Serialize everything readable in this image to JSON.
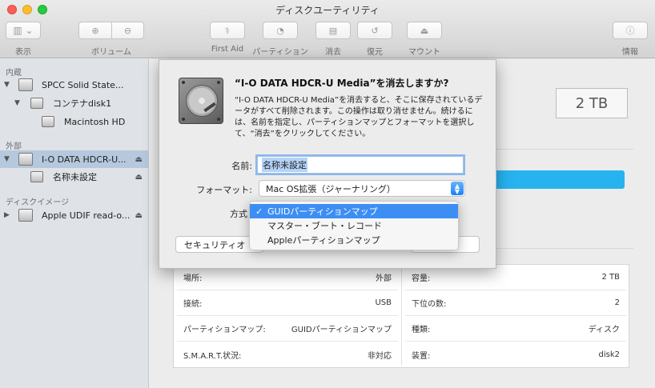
{
  "window": {
    "title": "ディスクユーティリティ"
  },
  "toolbar": {
    "view_label": "表示",
    "volume_label": "ボリューム",
    "first_aid_label": "First Aid",
    "partition_label": "パーティション",
    "erase_label": "消去",
    "restore_label": "復元",
    "mount_label": "マウント",
    "info_label": "情報"
  },
  "sidebar": {
    "sections": {
      "internal": "内蔵",
      "external": "外部",
      "images": "ディスクイメージ"
    },
    "items": [
      {
        "label": "SPCC Solid State..."
      },
      {
        "label": "コンテナdisk1"
      },
      {
        "label": "Macintosh HD"
      },
      {
        "label": "I-O DATA HDCR-U..."
      },
      {
        "label": "名称未設定"
      },
      {
        "label": "Apple UDIF read-o..."
      }
    ]
  },
  "main": {
    "capacity": "2 TB",
    "info_rows": [
      {
        "label": "場所:",
        "value": "外部"
      },
      {
        "label": "接続:",
        "value": "USB"
      },
      {
        "label": "パーティションマップ:",
        "value": "GUIDパーティションマップ"
      },
      {
        "label": "S.M.A.R.T.状況:",
        "value": "非対応"
      },
      {
        "label": "容量:",
        "value": "2 TB"
      },
      {
        "label": "下位の数:",
        "value": "2"
      },
      {
        "label": "種類:",
        "value": "ディスク"
      },
      {
        "label": "装置:",
        "value": "disk2"
      }
    ]
  },
  "dialog": {
    "title": "“I-O DATA HDCR-U Media”を消去しますか?",
    "body": "“I-O DATA HDCR-U Media”を消去すると、そこに保存されているデータがすべて削除されます。この操作は取り消せません。続けるには、名前を指定し、パーティションマップとフォーマットを選択して、“消去”をクリックしてください。",
    "name_label": "名前:",
    "name_value": "名称未設定",
    "format_label": "フォーマット:",
    "format_value": "Mac OS拡張（ジャーナリング）",
    "scheme_label": "方式",
    "security_button": "セキュリティオ"
  },
  "scheme_menu": {
    "options": [
      "GUIDパーティションマップ",
      "マスター・ブート・レコード",
      "Appleパーティションマップ"
    ],
    "selected_index": 0,
    "check_mark": "✓"
  },
  "colors": {
    "selection": "#3d8ef4",
    "sidebar_selected": "#b5c8dd",
    "capacity_bar": "#26b3f0"
  }
}
